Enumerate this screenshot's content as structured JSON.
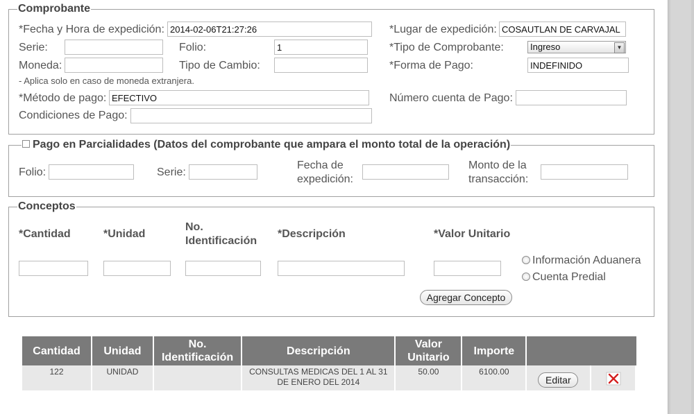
{
  "comprobante": {
    "legend": "Comprobante",
    "fecha_label": "*Fecha y Hora de expedición:",
    "fecha_value": "2014-02-06T21:27:26",
    "lugar_label": "*Lugar de expedición:",
    "lugar_value": "COSAUTLAN DE CARVAJAL",
    "serie_label": "Serie:",
    "serie_value": "",
    "folio_label": "Folio:",
    "folio_value": "1",
    "tipo_comprobante_label": "*Tipo de Comprobante:",
    "tipo_comprobante_value": "Ingreso",
    "moneda_label": "Moneda:",
    "moneda_value": "",
    "tipo_cambio_label": "Tipo de Cambio:",
    "tipo_cambio_value": "",
    "forma_pago_label": "*Forma de Pago:",
    "forma_pago_value": "INDEFINIDO",
    "moneda_note": "- Aplica solo en caso de moneda extranjera.",
    "metodo_pago_label": "*Método de pago:",
    "metodo_pago_value": "EFECTIVO",
    "numero_cuenta_label": "Número cuenta de Pago:",
    "numero_cuenta_value": "",
    "condiciones_label": "Condiciones de Pago:",
    "condiciones_value": ""
  },
  "parcialidades": {
    "legend": "Pago en Parcialidades (Datos del comprobante que ampara el monto total de la operación)",
    "folio_label": "Folio:",
    "serie_label": "Serie:",
    "fecha_label": "Fecha de expedición:",
    "monto_label": "Monto de la transacción:"
  },
  "conceptos": {
    "legend": "Conceptos",
    "cantidad_header": "*Cantidad",
    "unidad_header": "*Unidad",
    "no_ident_header": "No. Identificación",
    "descripcion_header": "*Descripción",
    "valor_unitario_header": "*Valor Unitario",
    "radio_aduanera": "Información Aduanera",
    "radio_predial": "Cuenta Predial",
    "agregar_button": "Agregar Concepto"
  },
  "table": {
    "headers": [
      "Cantidad",
      "Unidad",
      "No. Identificación",
      "Descripción",
      "Valor Unitario",
      "Importe",
      ""
    ],
    "rows": [
      {
        "cantidad": "122",
        "unidad": "UNIDAD",
        "no_ident": "",
        "descripcion": "CONSULTAS MEDICAS DEL 1 AL 31 DE ENERO DEL 2014",
        "valor_unitario": "50.00",
        "importe": "6100.00",
        "edit_label": "Editar",
        "delete_icon": "red-x-icon"
      }
    ]
  },
  "colors": {
    "table_header_bg": "#7a7a7a",
    "table_row_bg": "#e8e8e8",
    "delete_red": "#d42020"
  }
}
